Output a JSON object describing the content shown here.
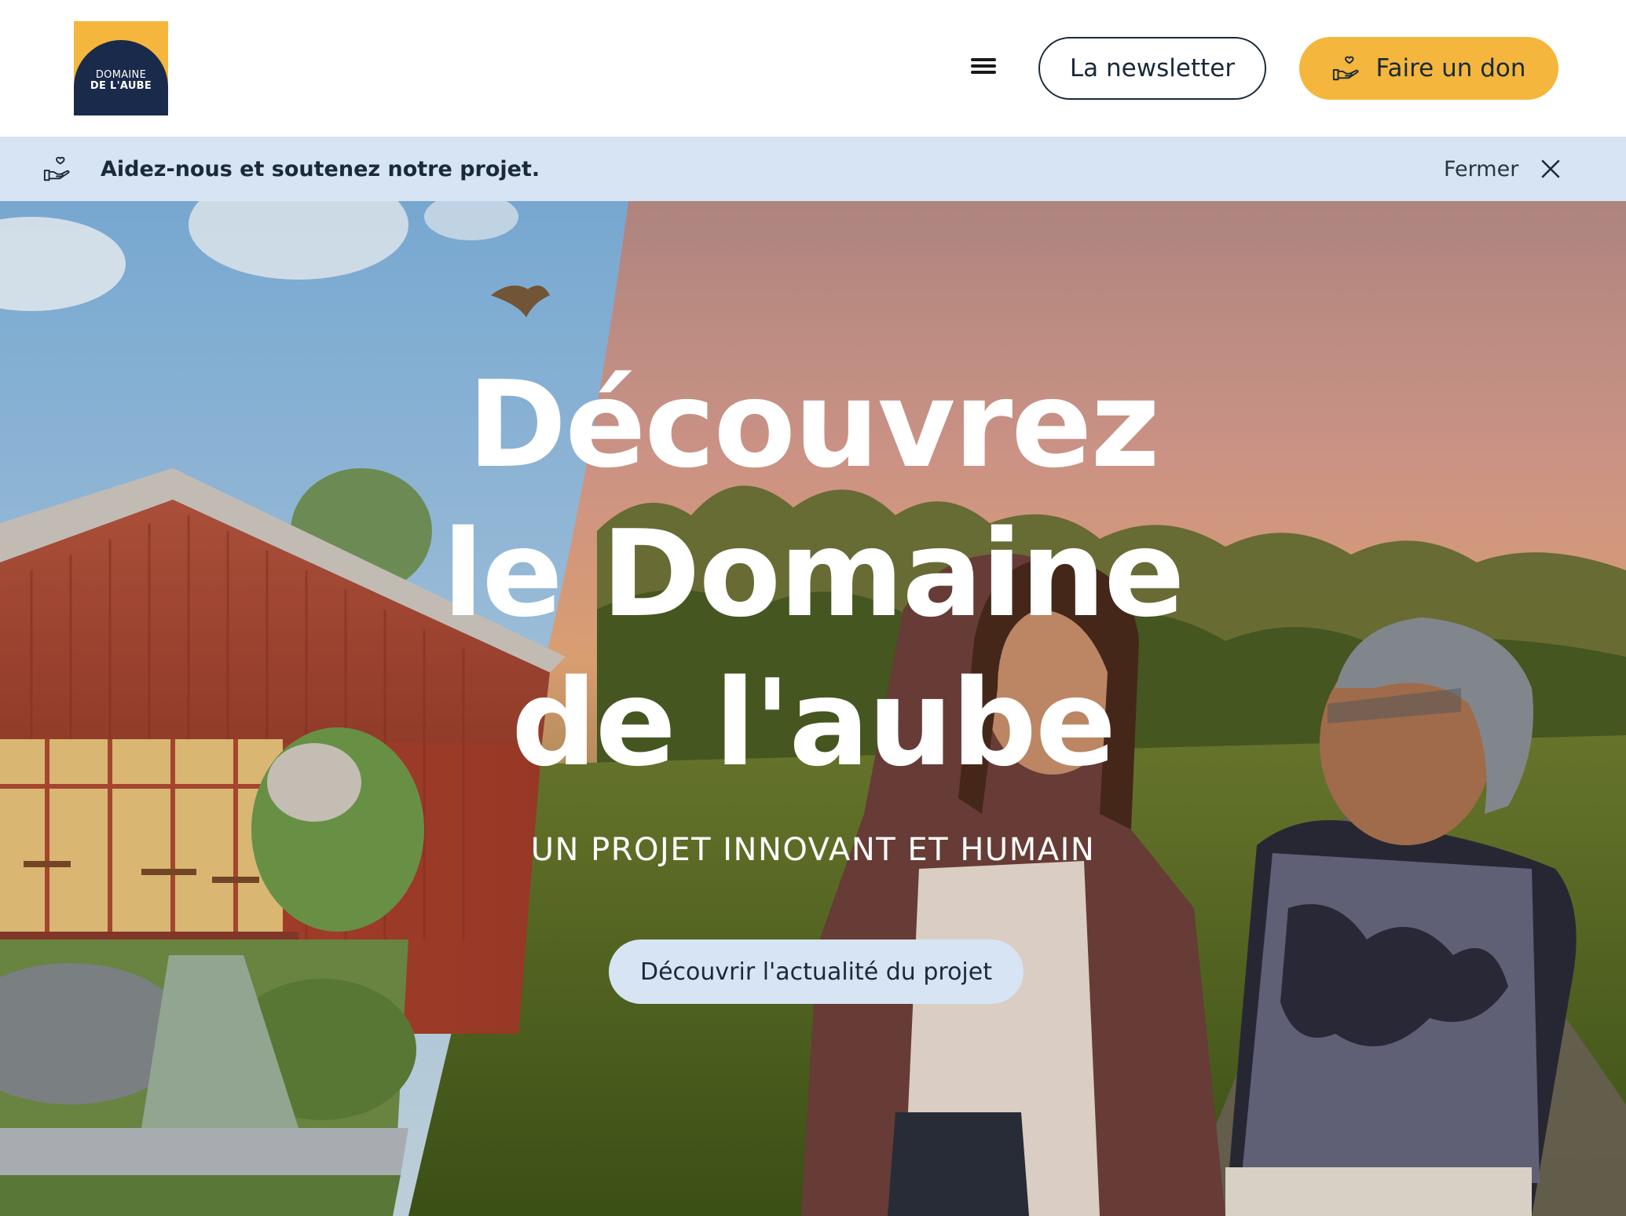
{
  "header": {
    "logo": {
      "line1": "DOMAINE",
      "line2": "DE L'AUBE"
    },
    "menu_icon": "hamburger-menu-icon",
    "newsletter_label": "La newsletter",
    "donate_label": "Faire un don",
    "donate_icon": "heart-hand-icon"
  },
  "banner": {
    "icon": "heart-hand-icon",
    "message": "Aidez-nous et soutenez notre projet.",
    "close_label": "Fermer",
    "close_icon": "close-icon"
  },
  "hero": {
    "title_lines": [
      "Découvrez",
      "le Domaine",
      "de l'aube"
    ],
    "subtitle": "UN PROJET INNOVANT ET HUMAIN",
    "cta_label": "Découvrir l'actualité du projet"
  },
  "colors": {
    "accent_yellow": "#f4b63c",
    "navy": "#1a2a4a",
    "banner_blue": "#d6e4f3",
    "text_dark": "#1a2a3a"
  }
}
